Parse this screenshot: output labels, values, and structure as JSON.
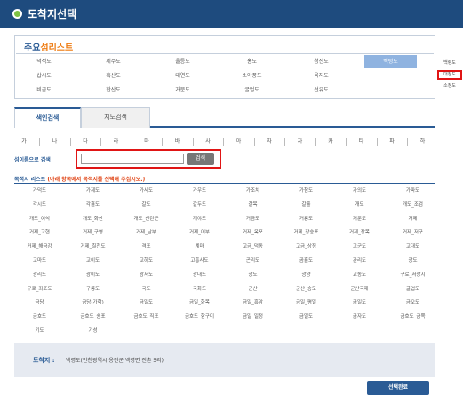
{
  "window": {
    "title": "도착지선택"
  },
  "major": {
    "heading_prefix": "주요",
    "heading_suffix": "섬리스트",
    "islands": [
      "덕적도",
      "제주도",
      "울릉도",
      "홍도",
      "청산도",
      "백령도",
      "삽시도",
      "흑산도",
      "대연도",
      "소야풍도",
      "육지도",
      "",
      "비금도",
      "한산도",
      "거문도",
      "굴업도",
      "선유도",
      ""
    ],
    "selected_index": 5
  },
  "popup": {
    "items": [
      "백령도",
      "대청도",
      "소청도"
    ],
    "highlight_index": 1
  },
  "tabs": {
    "index": "색인검색",
    "map": "지도검색"
  },
  "consonants": [
    "가",
    "나",
    "다",
    "라",
    "마",
    "바",
    "사",
    "아",
    "자",
    "차",
    "카",
    "타",
    "파",
    "하"
  ],
  "search": {
    "label": "섬이름으로 검색",
    "value": "",
    "placeholder": "",
    "button": "검색"
  },
  "list": {
    "heading": "목적지 리스트",
    "hint": "(아래 항목에서 목적지를 선택해 주십시오.)",
    "items": [
      "가덕도",
      "가제도",
      "가사도",
      "가우도",
      "가조치",
      "가참도",
      "가의도",
      "가파도",
      "각시도",
      "각흘도",
      "갈도",
      "갈두도",
      "갈목",
      "갈흘",
      "개도",
      "개도_조검",
      "개도_여석",
      "개도_화산",
      "개도_신란곤",
      "개야도",
      "거금도",
      "거룡도",
      "거문도",
      "거제",
      "거제_고현",
      "거제_구영",
      "거제_남부",
      "거제_어부",
      "거제_옥포",
      "거제_장승포",
      "거제_장목",
      "거제_저구",
      "거제_해금강",
      "거제_칠천도",
      "격포",
      "계마",
      "고금_덕동",
      "고금_상정",
      "고군도",
      "고대도",
      "고마도",
      "고이도",
      "고하도",
      "고흥사도",
      "곤리도",
      "곰흘도",
      "관리도",
      "광도",
      "광리도",
      "광이도",
      "광서도",
      "광대도",
      "광도",
      "광양",
      "교동도",
      "구로_서상시",
      "구로_좌포도",
      "구룡도",
      "국도",
      "국화도",
      "군산",
      "군산_송도",
      "군산국제",
      "굴업도",
      "금당",
      "금당(가학)",
      "금일도",
      "금일_화목",
      "금일_흥암",
      "금일_평일",
      "금일도",
      "금오도",
      "금호도",
      "금호도_송포",
      "금호도_직포",
      "금호도_함구미",
      "금일_일정",
      "금일도",
      "금자도",
      "금호도_금쪽",
      "기도",
      "기성"
    ]
  },
  "destination": {
    "label": "도착지 :",
    "value": "백령도(인천광역시 옹진군 백령면 진촌 5리)"
  },
  "confirm_button": "선택완료"
}
